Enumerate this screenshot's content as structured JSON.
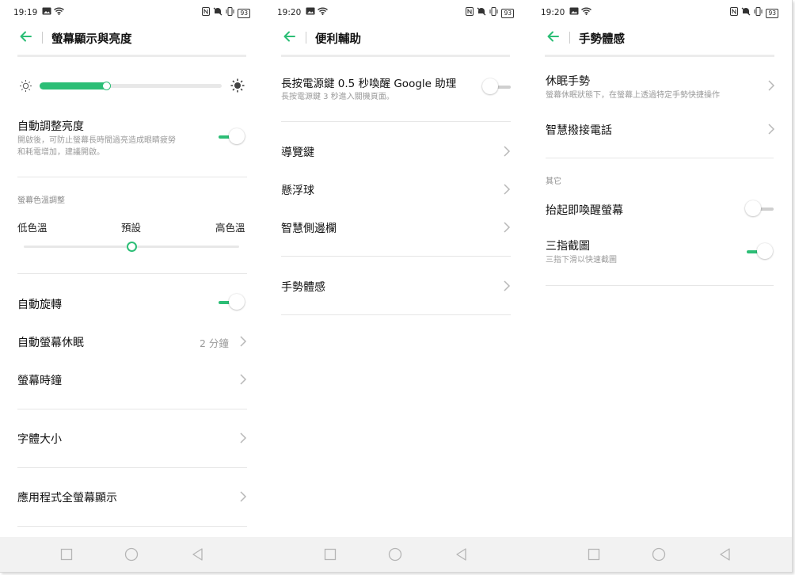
{
  "colors": {
    "accent": "#2cbe76",
    "divider": "#e6e6e6",
    "subtext": "#9a9a9a",
    "navbar": "#f2f2f2"
  },
  "screens": [
    {
      "status": {
        "time": "19:19",
        "battery": "93"
      },
      "title": "螢幕顯示與亮度",
      "brightness": {
        "level": 0.37
      },
      "auto_brightness": {
        "label": "自動調整亮度",
        "desc_line1": "開啟後，可防止螢幕長時間過亮造成眼睛疲勞",
        "desc_line2": "和耗電增加，建議開啟。",
        "on": true
      },
      "color_temp": {
        "section": "螢幕色溫調整",
        "low": "低色溫",
        "default": "預設",
        "high": "高色溫",
        "position": 0.5
      },
      "auto_rotate": {
        "label": "自動旋轉",
        "on": true
      },
      "auto_sleep": {
        "label": "自動螢幕休眠",
        "value": "2 分鐘"
      },
      "screen_clock": {
        "label": "螢幕時鐘"
      },
      "font_size": {
        "label": "字體大小"
      },
      "fullscreen_apps": {
        "label": "應用程式全螢幕顯示"
      }
    },
    {
      "status": {
        "time": "19:20",
        "battery": "93"
      },
      "title": "便利輔助",
      "google": {
        "label": "長按電源鍵 0.5 秒喚醒 Google 助理",
        "desc": "長按電源鍵 3 秒進入關機頁面。",
        "on": false
      },
      "items": [
        {
          "label": "導覽鍵"
        },
        {
          "label": "懸浮球"
        },
        {
          "label": "智慧側邊欄"
        },
        {
          "label": "手勢體感"
        }
      ]
    },
    {
      "status": {
        "time": "19:20",
        "battery": "93"
      },
      "title": "手勢體感",
      "sleep_gesture": {
        "label": "休眠手勢",
        "desc": "螢幕休眠狀態下，在螢幕上透過特定手勢快捷操作"
      },
      "smart_answer": {
        "label": "智慧撥接電話"
      },
      "section_other": "其它",
      "raise_wake": {
        "label": "抬起即喚醒螢幕",
        "on": false
      },
      "three_finger": {
        "label": "三指截圖",
        "desc": "三指下滑以快速截圖",
        "on": true
      }
    }
  ]
}
